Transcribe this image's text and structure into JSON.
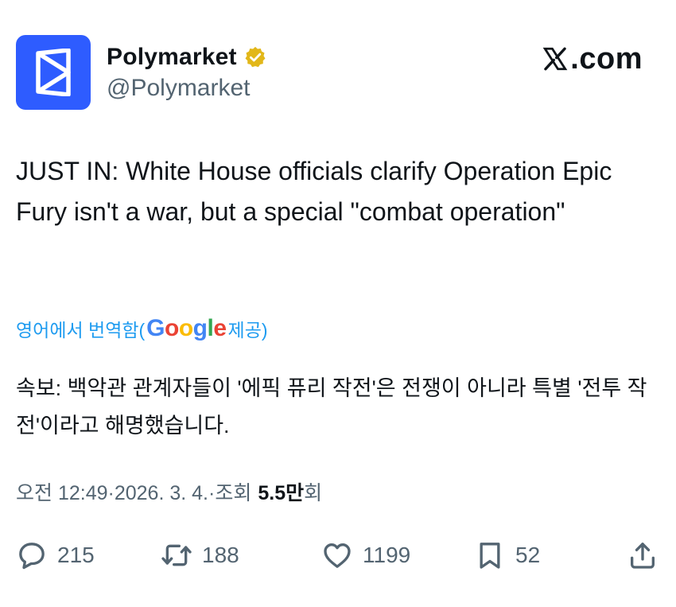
{
  "author": {
    "display_name": "Polymarket",
    "handle": "@Polymarket",
    "verified": true,
    "avatar_icon": "polymarket-logo-icon",
    "avatar_color": "#2e5cff"
  },
  "brand": {
    "site_label": ".com",
    "logo_icon": "x-logo-icon"
  },
  "tweet": {
    "text": "JUST IN: White House officials clarify Operation Epic Fury isn't a war, but a special \"combat operation\""
  },
  "translation": {
    "prefix": "영어에서 번역함(",
    "google_letters": [
      "G",
      "o",
      "o",
      "g",
      "l",
      "e"
    ],
    "suffix": " 제공)",
    "translated_text": "속보: 백악관 관계자들이 '에픽 퓨리 작전'은 전쟁이 아니라 특별 '전투 작전'이라고 해명했습니다."
  },
  "meta": {
    "time": "오전 12:49",
    "separator": " · ",
    "date": "2026. 3. 4.",
    "views_label": "조회",
    "views_count": "5.5만",
    "views_unit": "회"
  },
  "actions": {
    "reply_count": "215",
    "retweet_count": "188",
    "like_count": "1199",
    "bookmark_count": "52"
  },
  "colors": {
    "accent": "#1d9bf0",
    "secondary_text": "#536471",
    "primary_text": "#0f1419",
    "verified_gold": "#e2b719"
  }
}
